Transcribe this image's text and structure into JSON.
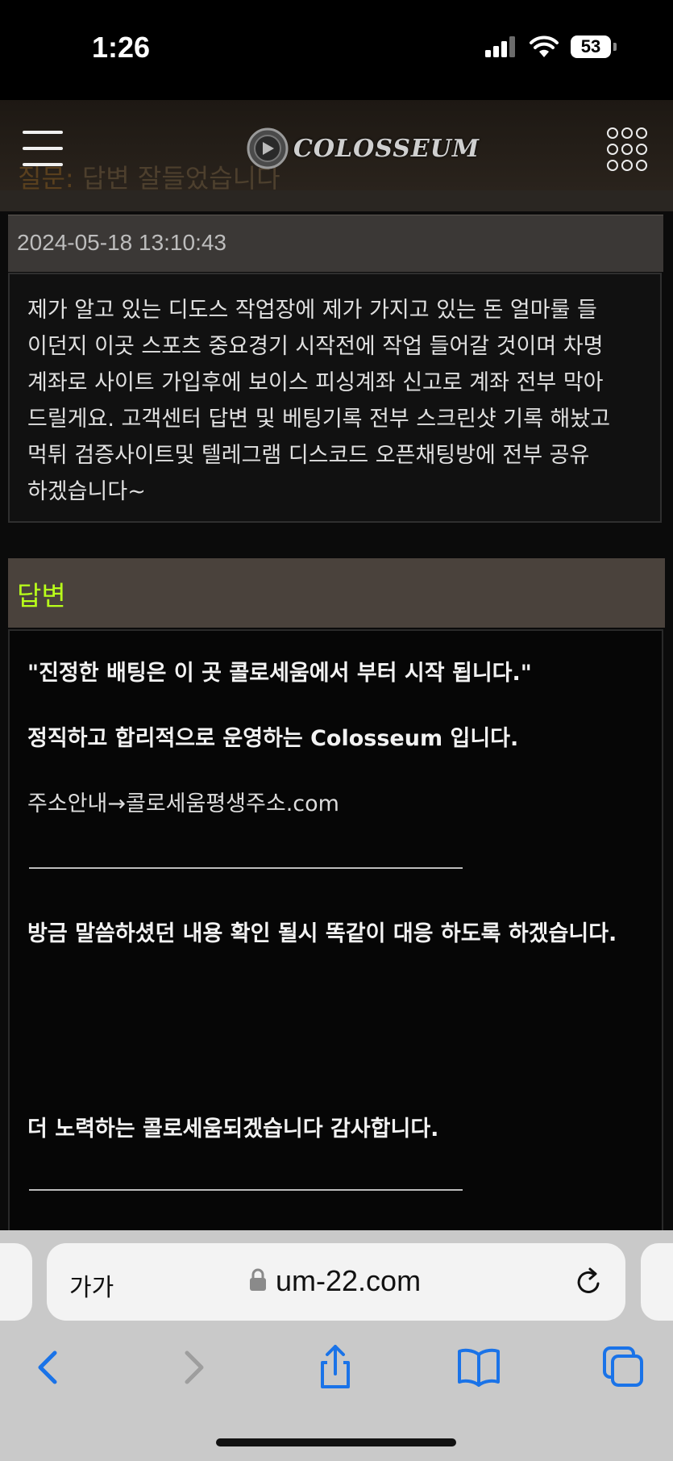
{
  "status_bar": {
    "time": "1:26",
    "battery": "53"
  },
  "header": {
    "logo_text": "COLOSSEUM",
    "ghost_title_prefix": "질문:",
    "ghost_title": "답변 잘들었습니다"
  },
  "post": {
    "date": "2024-05-18 13:10:43",
    "question_lines": [
      "제가 알고 있는 디도스 작업장에 제가 가지고 있는 돈 얼마룰 들",
      "이던지 이곳 스포츠 중요경기 시작전에 작업 들어갈 것이며 차명",
      "계좌로 사이트 가입후에 보이스 피싱계좌 신고로 계좌 전부 막아",
      "드릴게요. 고객센터 답변 및 베팅기록 전부 스크린샷 기록 해놨고",
      "먹튀 검증사이트및 텔레그램 디스코드 오픈채팅방에 전부 공유",
      "하겠습니다~"
    ]
  },
  "answer": {
    "label": "답변",
    "line1": "\"진정한 배팅은 이 곳 콜로세움에서 부터 시작 됩니다.\"",
    "line2": "정직하고 합리적으로 운영하는 Colosseum 입니다.",
    "line3": "주소안내→콜로세움평생주소.com",
    "line4": "방금 말씀하셨던 내용 확인 될시 똑같이 대응 하도록 하겠습니다.",
    "line5": "더 노력하는 콜로세움되겠습니다 감사합니다."
  },
  "browser": {
    "text_size_label": "가가",
    "url": "um-22.com"
  }
}
